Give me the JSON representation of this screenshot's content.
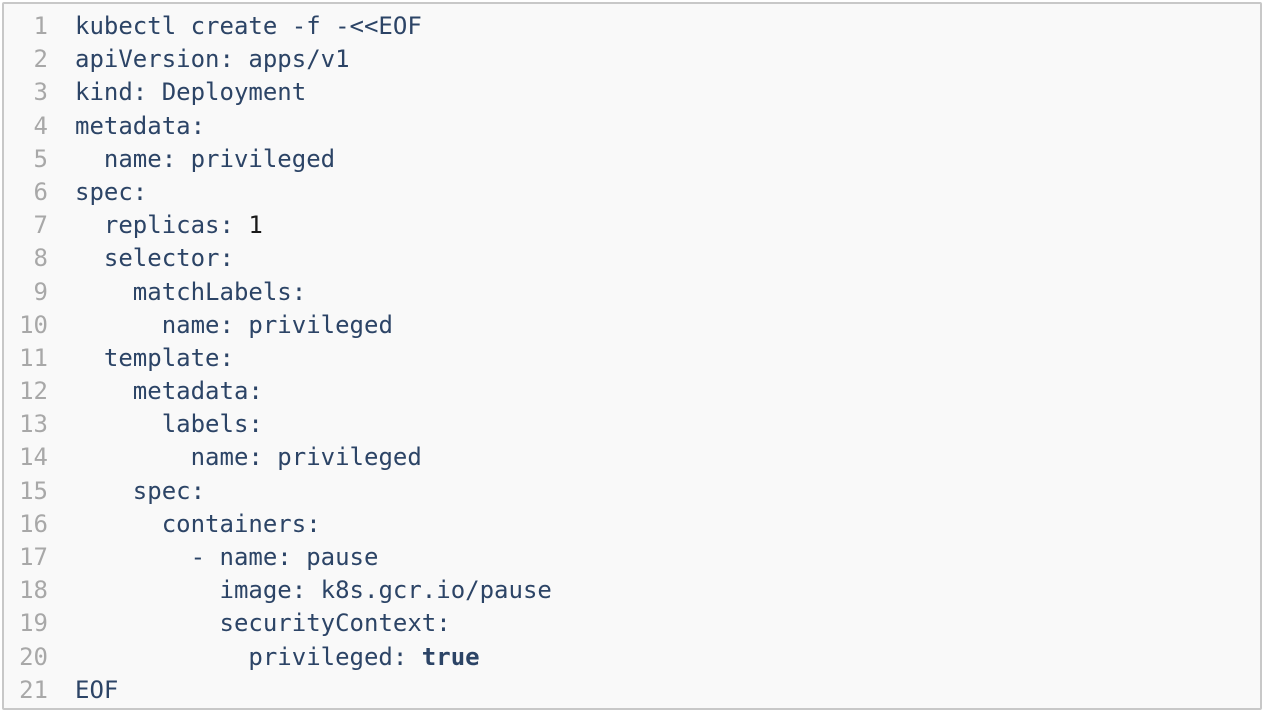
{
  "code": {
    "lines": [
      {
        "num": "1",
        "indent": "",
        "key": "kubectl create -f -<<EOF",
        "sep": "",
        "value": "",
        "vtype": "plain"
      },
      {
        "num": "2",
        "indent": "",
        "key": "apiVersion",
        "sep": ": ",
        "value": "apps/v1",
        "vtype": "str"
      },
      {
        "num": "3",
        "indent": "",
        "key": "kind",
        "sep": ": ",
        "value": "Deployment",
        "vtype": "str"
      },
      {
        "num": "4",
        "indent": "",
        "key": "metadata",
        "sep": ":",
        "value": "",
        "vtype": "str"
      },
      {
        "num": "5",
        "indent": "  ",
        "key": "name",
        "sep": ": ",
        "value": "privileged",
        "vtype": "str"
      },
      {
        "num": "6",
        "indent": "",
        "key": "spec",
        "sep": ":",
        "value": "",
        "vtype": "str"
      },
      {
        "num": "7",
        "indent": "  ",
        "key": "replicas",
        "sep": ": ",
        "value": "1",
        "vtype": "num"
      },
      {
        "num": "8",
        "indent": "  ",
        "key": "selector",
        "sep": ":",
        "value": "",
        "vtype": "str"
      },
      {
        "num": "9",
        "indent": "    ",
        "key": "matchLabels",
        "sep": ":",
        "value": "",
        "vtype": "str"
      },
      {
        "num": "10",
        "indent": "      ",
        "key": "name",
        "sep": ": ",
        "value": "privileged",
        "vtype": "str"
      },
      {
        "num": "11",
        "indent": "  ",
        "key": "template",
        "sep": ":",
        "value": "",
        "vtype": "str"
      },
      {
        "num": "12",
        "indent": "    ",
        "key": "metadata",
        "sep": ":",
        "value": "",
        "vtype": "str"
      },
      {
        "num": "13",
        "indent": "      ",
        "key": "labels",
        "sep": ":",
        "value": "",
        "vtype": "str"
      },
      {
        "num": "14",
        "indent": "        ",
        "key": "name",
        "sep": ": ",
        "value": "privileged",
        "vtype": "str"
      },
      {
        "num": "15",
        "indent": "    ",
        "key": "spec",
        "sep": ":",
        "value": "",
        "vtype": "str"
      },
      {
        "num": "16",
        "indent": "      ",
        "key": "containers",
        "sep": ":",
        "value": "",
        "vtype": "str"
      },
      {
        "num": "17",
        "indent": "        ",
        "key": "- name",
        "sep": ": ",
        "value": "pause",
        "vtype": "str"
      },
      {
        "num": "18",
        "indent": "          ",
        "key": "image",
        "sep": ": ",
        "value": "k8s.gcr.io/pause",
        "vtype": "str"
      },
      {
        "num": "19",
        "indent": "          ",
        "key": "securityContext",
        "sep": ":",
        "value": "",
        "vtype": "str"
      },
      {
        "num": "20",
        "indent": "            ",
        "key": "privileged",
        "sep": ": ",
        "value": "true",
        "vtype": "bool"
      },
      {
        "num": "21",
        "indent": "",
        "key": "EOF",
        "sep": "",
        "value": "",
        "vtype": "plain"
      }
    ]
  }
}
